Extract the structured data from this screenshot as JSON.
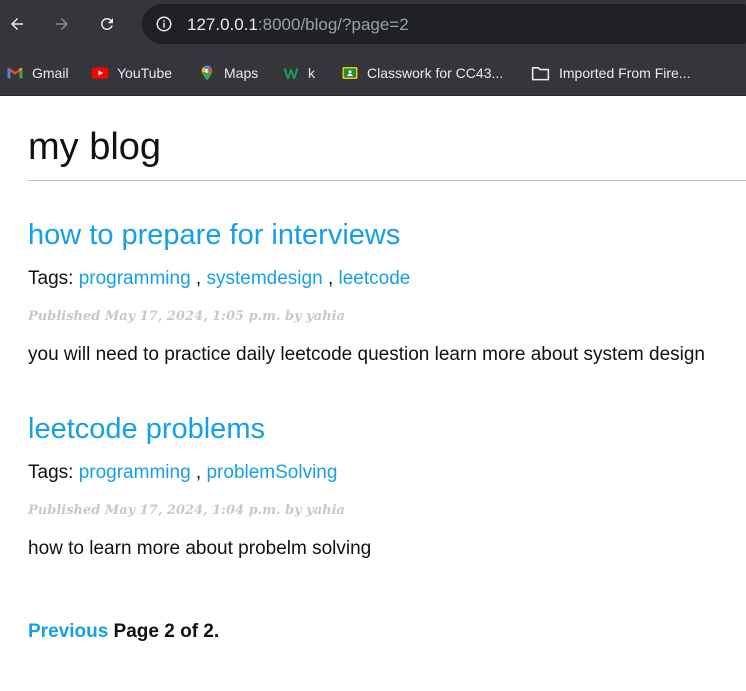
{
  "browser": {
    "url_host": "127.0.0.1",
    "url_rest": ":8000/blog/?page=2",
    "bookmarks": [
      {
        "label": "Gmail",
        "icon": "gmail-icon"
      },
      {
        "label": "YouTube",
        "icon": "youtube-icon"
      },
      {
        "label": "Maps",
        "icon": "maps-icon"
      },
      {
        "label": "k",
        "icon": "w-app-icon"
      },
      {
        "label": "Classwork for CC43...",
        "icon": "classroom-icon"
      },
      {
        "label": "Imported From Fire...",
        "icon": "folder-icon"
      }
    ]
  },
  "page": {
    "site_title": "my blog",
    "tags_prefix": "Tags:",
    "tag_separator": ",",
    "posts": [
      {
        "title": "how to prepare for interviews",
        "tags": [
          "programming",
          "systemdesign",
          "leetcode"
        ],
        "published": "Published May 17, 2024, 1:05 p.m. by yahia",
        "body": "you will need to practice daily leetcode question learn more about system design"
      },
      {
        "title": "leetcode problems",
        "tags": [
          "programming",
          "problemSolving"
        ],
        "published": "Published May 17, 2024, 1:04 p.m. by yahia",
        "body": "how to learn more about probelm solving"
      }
    ],
    "pagination": {
      "previous_label": "Previous",
      "page_info": "Page 2 of 2."
    }
  },
  "colors": {
    "link": "#13a0e8",
    "chrome_bg": "#35363a",
    "omnibox_bg": "#202124"
  }
}
